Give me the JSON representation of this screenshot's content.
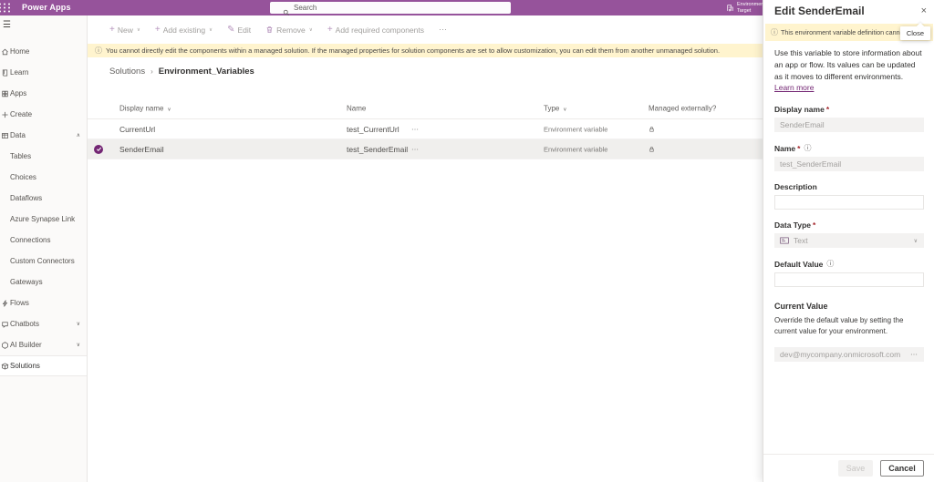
{
  "colors": {
    "accent": "#96539b",
    "brand": "#742774",
    "banner": "#fff4ce",
    "selrow": "#f0efed",
    "fieldbg": "#f3f2f1"
  },
  "icons": {
    "hamburger": "☰",
    "plus": "+",
    "pencil": "✎",
    "ellipsis": "⋯",
    "chevron_down": "∨",
    "chevron_up": "∧",
    "close": "×",
    "info": "ⓘ",
    "breadcrumb_sep": "›"
  },
  "header": {
    "app_title": "Power Apps",
    "search_placeholder": "Search",
    "environment_line1": "Environment",
    "environment_line2": "Target"
  },
  "sidebar": {
    "items": [
      {
        "label": "Home",
        "icon": "home"
      },
      {
        "label": "Learn",
        "icon": "learn"
      },
      {
        "label": "Apps",
        "icon": "apps"
      },
      {
        "label": "Create",
        "icon": "create"
      },
      {
        "label": "Data",
        "icon": "data",
        "expanded": true
      },
      {
        "label": "Tables",
        "child": true
      },
      {
        "label": "Choices",
        "child": true
      },
      {
        "label": "Dataflows",
        "child": true
      },
      {
        "label": "Azure Synapse Link",
        "child": true
      },
      {
        "label": "Connections",
        "child": true
      },
      {
        "label": "Custom Connectors",
        "child": true
      },
      {
        "label": "Gateways",
        "child": true
      },
      {
        "label": "Flows",
        "icon": "flows"
      },
      {
        "label": "Chatbots",
        "icon": "chatbots",
        "collapsed": true
      },
      {
        "label": "AI Builder",
        "icon": "ai-builder",
        "collapsed": true
      },
      {
        "label": "Solutions",
        "icon": "solutions",
        "selected": true
      }
    ]
  },
  "toolbar": {
    "new_label": "New",
    "add_existing_label": "Add existing",
    "edit_label": "Edit",
    "remove_label": "Remove",
    "add_required_label": "Add required components"
  },
  "banner": {
    "text": "You cannot directly edit the components within a managed solution. If the managed properties for solution components are set to allow customization, you can edit them from another unmanaged solution."
  },
  "breadcrumb": {
    "root": "Solutions",
    "current": "Environment_Variables"
  },
  "table": {
    "headers": {
      "display_name": "Display name",
      "name": "Name",
      "type": "Type",
      "managed": "Managed externally?"
    },
    "rows": [
      {
        "display_name": "CurrentUrl",
        "name": "test_CurrentUrl",
        "type": "Environment variable"
      },
      {
        "display_name": "SenderEmail",
        "name": "test_SenderEmail",
        "type": "Environment variable"
      }
    ]
  },
  "panel": {
    "title": "Edit SenderEmail",
    "close_tooltip": "Close",
    "warning": "This environment variable definition cannot be",
    "intro": "Use this variable to store information about an app or flow. Its values can be updated as it moves to different environments.",
    "learn_more_label": "Learn more",
    "required_mark": "*",
    "display_name_label": "Display name",
    "display_name_value": "SenderEmail",
    "name_label": "Name",
    "name_value": "test_SenderEmail",
    "description_label": "Description",
    "description_value": "",
    "data_type_label": "Data Type",
    "data_type_value": "Text",
    "default_value_label": "Default Value",
    "default_value_value": "",
    "current_value_heading": "Current Value",
    "current_value_help": "Override the default value by setting the current value for your environment.",
    "current_value_value": "dev@mycompany.onmicrosoft.com",
    "save_label": "Save",
    "cancel_label": "Cancel"
  }
}
